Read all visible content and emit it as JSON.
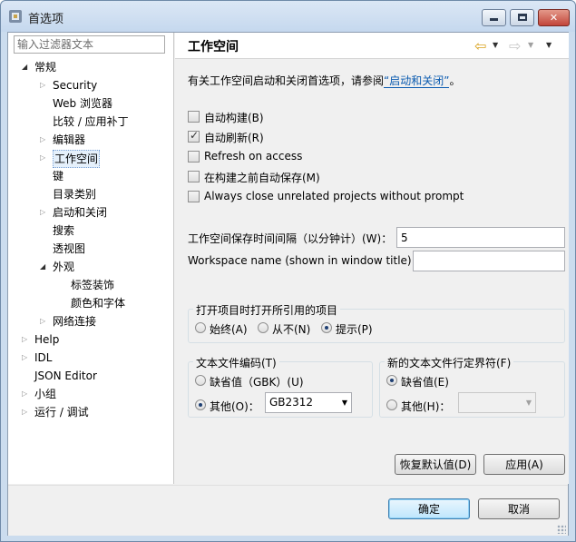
{
  "window": {
    "title": "首选项"
  },
  "filter": {
    "placeholder": "输入过滤器文本"
  },
  "tree": [
    {
      "label": "常规",
      "arrow": "◢",
      "level": 0
    },
    {
      "label": "Security",
      "arrow": "▷",
      "level": 1
    },
    {
      "label": "Web 浏览器",
      "arrow": "",
      "level": 1
    },
    {
      "label": "比较 / 应用补丁",
      "arrow": "",
      "level": 1
    },
    {
      "label": "编辑器",
      "arrow": "▷",
      "level": 1
    },
    {
      "label": "工作空间",
      "arrow": "▷",
      "level": 1,
      "selected": true
    },
    {
      "label": "键",
      "arrow": "",
      "level": 1
    },
    {
      "label": "目录类别",
      "arrow": "",
      "level": 1
    },
    {
      "label": "启动和关闭",
      "arrow": "▷",
      "level": 1
    },
    {
      "label": "搜索",
      "arrow": "",
      "level": 1
    },
    {
      "label": "透视图",
      "arrow": "",
      "level": 1
    },
    {
      "label": "外观",
      "arrow": "◢",
      "level": 1
    },
    {
      "label": "标签装饰",
      "arrow": "",
      "level": 2
    },
    {
      "label": "颜色和字体",
      "arrow": "",
      "level": 2
    },
    {
      "label": "网络连接",
      "arrow": "▷",
      "level": 1
    },
    {
      "label": "Help",
      "arrow": "▷",
      "level": 0
    },
    {
      "label": "IDL",
      "arrow": "▷",
      "level": 0
    },
    {
      "label": "JSON Editor",
      "arrow": "",
      "level": 0
    },
    {
      "label": "小组",
      "arrow": "▷",
      "level": 0
    },
    {
      "label": "运行 / 调试",
      "arrow": "▷",
      "level": 0
    }
  ],
  "header": {
    "title": "工作空间"
  },
  "page": {
    "description_prefix": "有关工作空间启动和关闭首选项，请参阅",
    "description_link": "“启动和关闭”",
    "description_suffix": "。",
    "options": [
      {
        "label": "自动构建(B)",
        "checked": false
      },
      {
        "label": "自动刷新(R)",
        "checked": true
      },
      {
        "label": "Refresh on access",
        "checked": false
      },
      {
        "label": "在构建之前自动保存(M)",
        "checked": false
      },
      {
        "label": "Always close unrelated projects without prompt",
        "checked": false
      }
    ],
    "save_interval": {
      "label": "工作空间保存时间间隔（以分钟计）(W)：",
      "value": "5"
    },
    "workspace_name": {
      "label": "Workspace name (shown in window title):",
      "value": ""
    },
    "open_refs": {
      "title": "打开项目时打开所引用的项目",
      "options": [
        "始终(A)",
        "从不(N)",
        "提示(P)"
      ],
      "selected": 2
    },
    "encoding": {
      "title": "文本文件编码(T)",
      "default_label": "缺省值（GBK）(U)",
      "other_label": "其他(O)：",
      "other_selected": true,
      "other_value": "GB2312"
    },
    "line_delim": {
      "title": "新的文本文件行定界符(F)",
      "default_label": "缺省值(E)",
      "other_label": "其他(H)：",
      "default_selected": true,
      "other_value": ""
    },
    "restore_label": "恢复默认值(D)",
    "apply_label": "应用(A)"
  },
  "footer": {
    "ok_label": "确定",
    "cancel_label": "取消"
  }
}
